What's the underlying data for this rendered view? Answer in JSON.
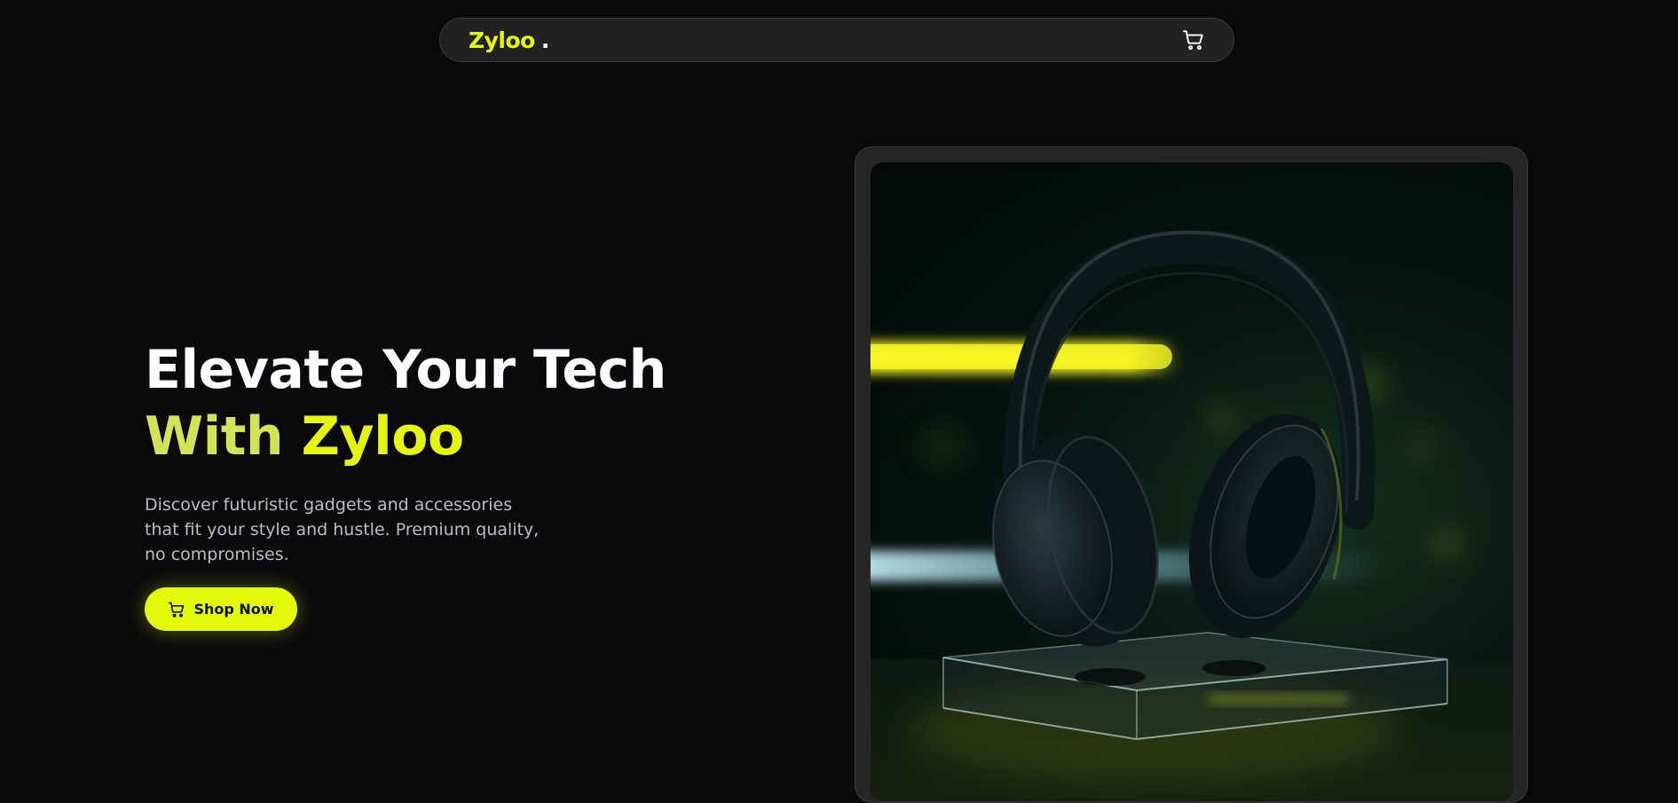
{
  "nav": {
    "logo_text": "Zyloo",
    "logo_dot": ".",
    "cart_icon": "cart-icon"
  },
  "hero": {
    "title_line1": "Elevate Your Tech",
    "title_with": "With",
    "title_brand": "Zyloo",
    "description": "Discover futuristic gadgets and accessories that fit your style and hustle. Premium quality, no compromises.",
    "cta_label": "Shop Now",
    "cta_icon": "cart-icon",
    "image_icon": "headphones-image"
  },
  "colors": {
    "background": "#0a0a0c",
    "accent": "#e5f70e",
    "accent_soft": "#d3e358",
    "nav_bg": "#222224",
    "text_muted": "#bdbdc2"
  }
}
